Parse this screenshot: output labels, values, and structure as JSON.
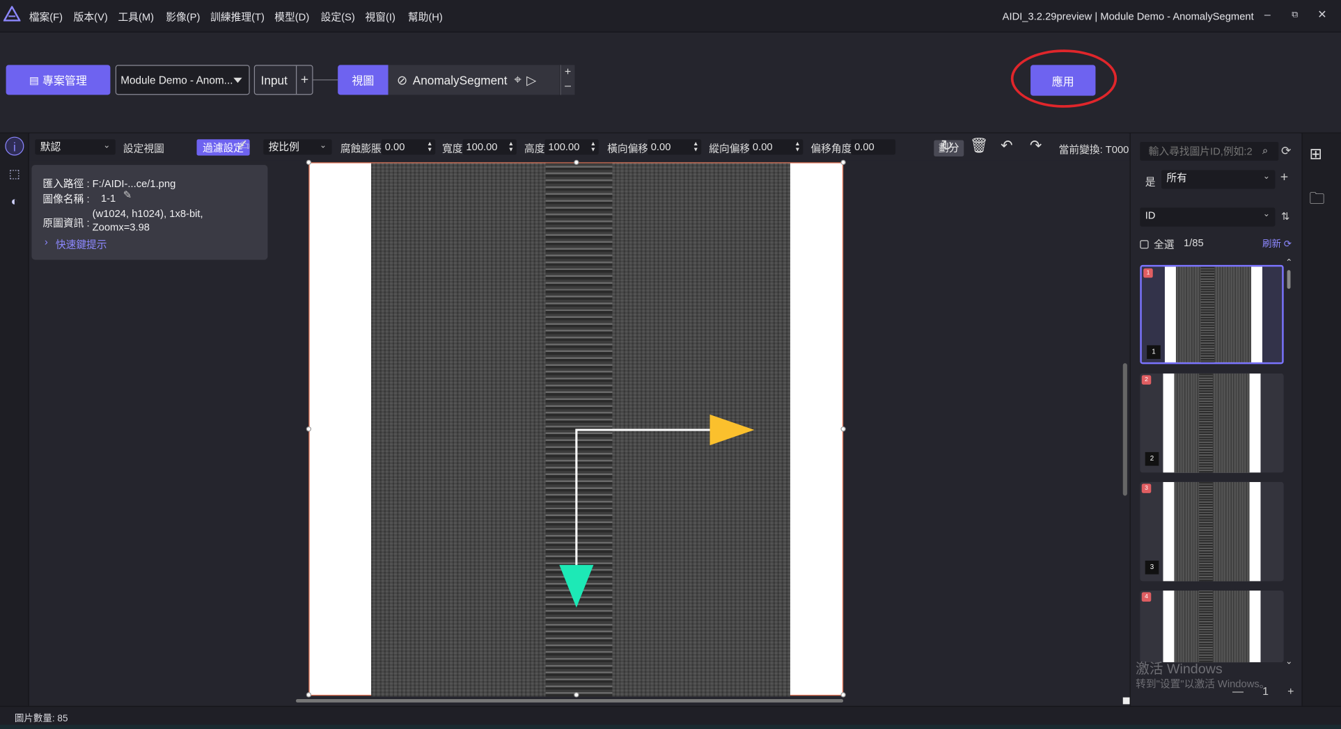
{
  "menu": {
    "items": [
      "檔案(F)",
      "版本(V)",
      "工具(M)",
      "影像(P)",
      "訓練推理(T)",
      "模型(D)",
      "設定(S)",
      "視窗(I)",
      "幫助(H)"
    ]
  },
  "window": {
    "title": "AIDI_3.2.29preview | Module Demo - AnomalySegment",
    "minimize": "–",
    "restore": "⧉",
    "close": "✕"
  },
  "pipeline": {
    "project_button": "專案管理",
    "project_select": "Module Demo - Anom...",
    "input_node": "Input",
    "input_plus": "+",
    "view_node": "視圖",
    "module_node": "AnomalySegment",
    "node_plus": "+",
    "node_minus": "–",
    "apply_button": "應用"
  },
  "params": {
    "preset": "默認",
    "set_view": "設定視圖",
    "filter_settings": "過濾設定",
    "scale_mode": "按比例",
    "erode_label": "腐蝕膨脹",
    "erode_value": "0.00",
    "width_label": "寬度",
    "width_value": "100.00",
    "height_label": "高度",
    "height_value": "100.00",
    "hshift_label": "橫向偏移",
    "hshift_value": "0.00",
    "vshift_label": "縱向偏移",
    "vshift_value": "0.00",
    "angle_label": "偏移角度",
    "angle_value": "0.00",
    "split_button": "劃分",
    "current_transform": "當前變換: T000"
  },
  "info": {
    "path": "匯入路徑 : F:/AIDI-...ce/1.png",
    "name_label": "圖像名稱 :",
    "name_value": "1-1",
    "original_label": "原圖資訊 :",
    "original_value_1": "(w1024, h1024), 1x8-bit,",
    "original_value_2": "Zoomx=3.98",
    "shortcut": "快速鍵提示"
  },
  "status": {
    "image_count": "圖片數量:   85"
  },
  "sidebar": {
    "search_placeholder": "輸入尋找圖片ID,例如:2",
    "flag_label": "是",
    "filter_value": "所有",
    "sort_value": "ID",
    "select_all": "全選",
    "page_count": "1/85",
    "refresh": "刷新",
    "thumbnails": [
      {
        "badge": "1",
        "index": "1"
      },
      {
        "badge": "2",
        "index": "2"
      },
      {
        "badge": "3",
        "index": "3"
      },
      {
        "badge": "4",
        "index": ""
      }
    ],
    "pager_minus": "—",
    "pager_value": "1",
    "pager_plus": "+"
  },
  "watermark": {
    "line1": "激活 Windows",
    "line2": "转到\"设置\"以激活 Windows。"
  },
  "colors": {
    "accent": "#6e63f0",
    "annotation_circle": "#e0262b",
    "x_axis_arrow": "#fbc02d",
    "y_axis_arrow": "#1de9b6"
  }
}
